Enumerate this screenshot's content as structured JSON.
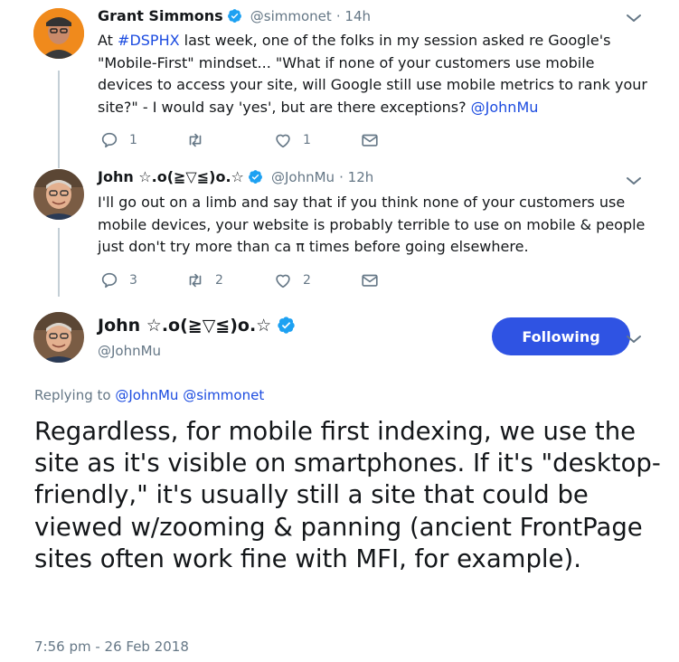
{
  "tweet1": {
    "name": "Grant Simmons",
    "handle": "@simmonet",
    "time": "· 14h",
    "text_parts": {
      "p1": "At ",
      "hashtag": "#DSPHX",
      "p2": " last week, one of the folks in my session asked re Google's \"Mobile-First\" mindset... \"What if none of your customers use mobile devices to access your site, will Google still use mobile metrics to rank your site?\" - I would say 'yes', but are there exceptions? ",
      "mention": "@JohnMu"
    },
    "reply_count": "1",
    "retweet_count": "",
    "like_count": "1"
  },
  "tweet2": {
    "name": "John ☆.o(≧▽≦)o.☆",
    "handle": "@JohnMu",
    "time": "· 12h",
    "text": "I'll go out on a limb and say that if you think none of your customers use mobile devices, your website is probably terrible to use on mobile & people just don't try more than ca π times before going elsewhere.",
    "reply_count": "3",
    "retweet_count": "2",
    "like_count": "2"
  },
  "main_tweet": {
    "name": "John ☆.o(≧▽≦)o.☆",
    "handle": "@JohnMu",
    "follow_label": "Following",
    "replying_prefix": "Replying to ",
    "replying_to_1": "@JohnMu",
    "replying_to_2": "@simmonet",
    "text": "Regardless, for mobile first indexing, we use the site as it's visible on smartphones. If it's \"desktop-friendly,\" it's usually still a site that could be viewed w/zooming & panning (ancient FrontPage sites often work fine with MFI, for example).",
    "timestamp": "7:56 pm - 26 Feb 2018"
  },
  "colors": {
    "accent": "#2f53e3",
    "link": "#1b4be0",
    "verified": "#1da1f2",
    "muted": "#657786",
    "thread_line": "#c4cfd6"
  }
}
